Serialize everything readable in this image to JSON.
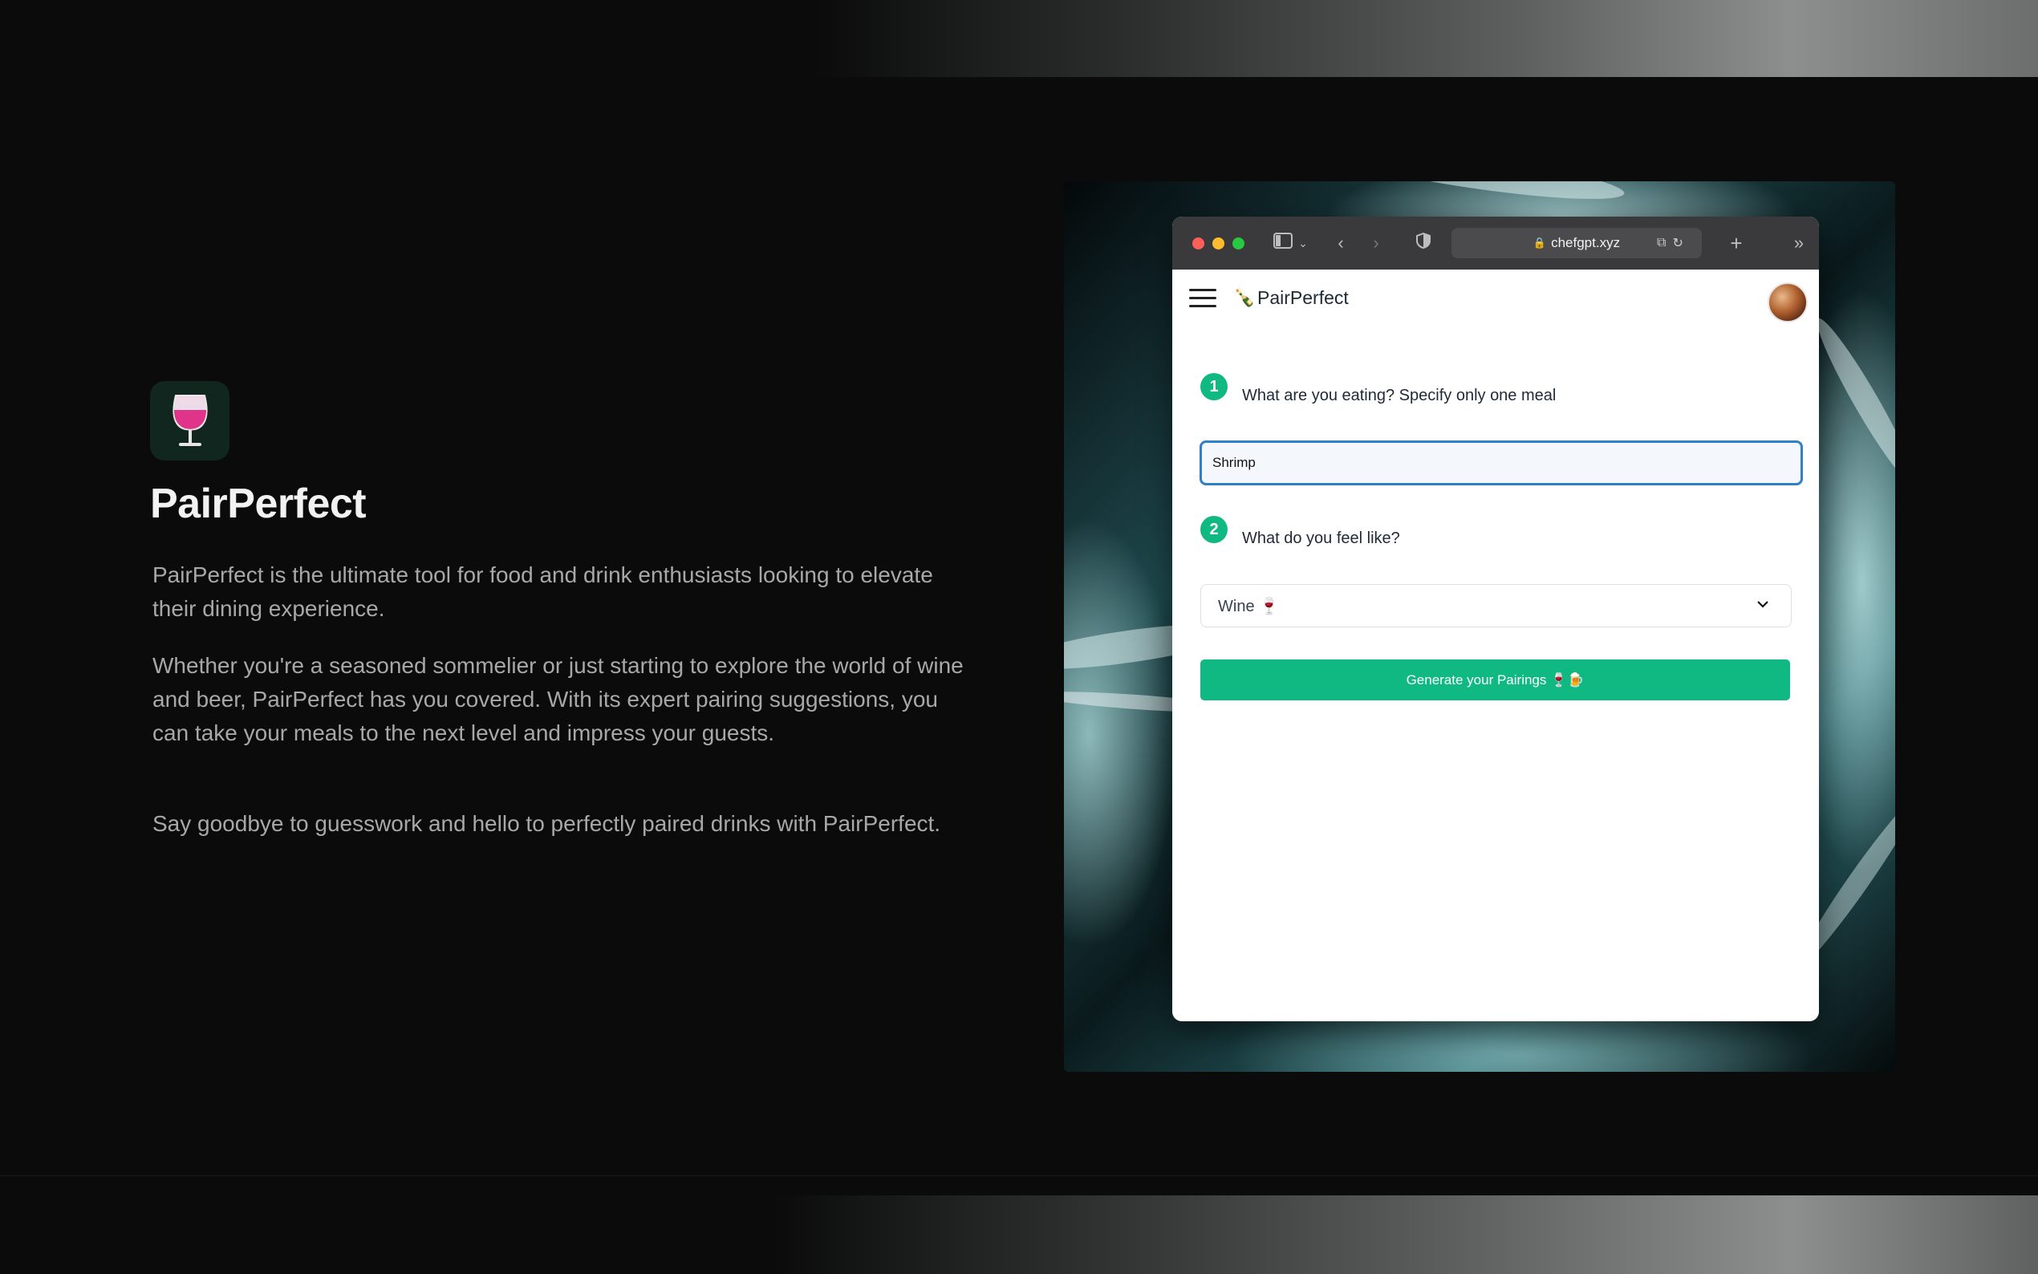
{
  "showcase": {
    "app_icon_emoji": "🍷",
    "title": "PairPerfect",
    "paragraphs": [
      "PairPerfect is the ultimate tool for food and drink enthusiasts looking to elevate their dining experience.",
      "Whether you're a seasoned sommelier or just starting to explore the world of wine and beer, PairPerfect has you covered. With its expert pairing suggestions, you can take your meals to the next level and impress your guests.",
      "Say goodbye to guesswork and hello to perfectly paired drinks with PairPerfect."
    ]
  },
  "browser": {
    "url": "chefgpt.xyz",
    "traffic_lights": [
      "#ff5f57",
      "#febc2e",
      "#28c840"
    ]
  },
  "app": {
    "brand_emoji": "🍾",
    "brand_name": "PairPerfect",
    "step1": {
      "number": "1",
      "label": "What are you eating? Specify only one meal",
      "value": "Shrimp "
    },
    "step2": {
      "number": "2",
      "label": "What do you feel like?",
      "selected": "Wine 🍷"
    },
    "generate_label": "Generate your Pairings 🍷🍺",
    "accent_color": "#10b981"
  }
}
